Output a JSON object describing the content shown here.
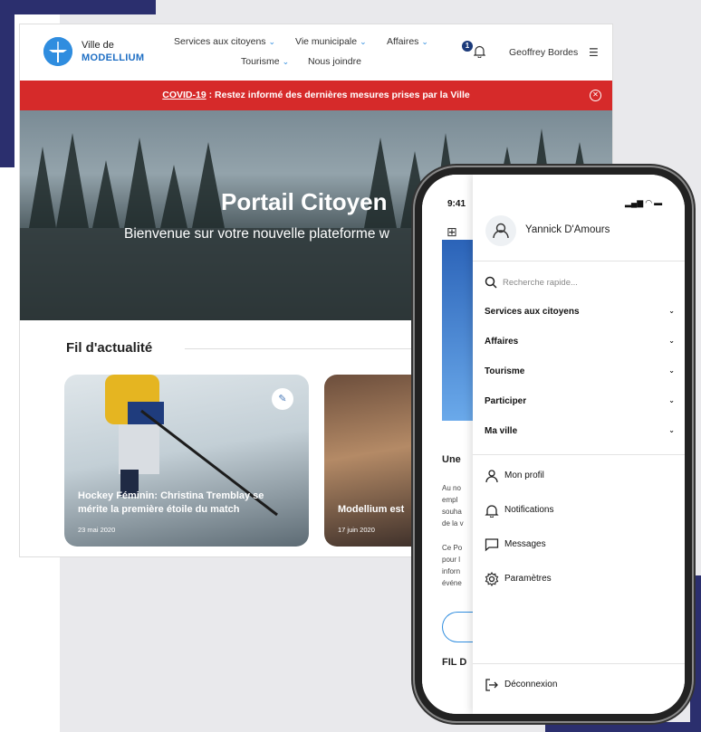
{
  "desktop": {
    "logo": {
      "line1": "Ville de",
      "line2": "MODELLIUM"
    },
    "nav": [
      {
        "label": "Services aux citoyens"
      },
      {
        "label": "Vie municipale"
      },
      {
        "label": "Affaires"
      },
      {
        "label": "Tourisme"
      },
      {
        "label": "Nous joindre"
      }
    ],
    "notifications_count": "1",
    "user_name": "Geoffrey Bordes",
    "covid": {
      "link": "COVID-19",
      "text": " : Restez informé des dernières mesures prises par la Ville"
    },
    "hero": {
      "title": "Portail Citoyen",
      "subtitle": "Bienvenue sur votre nouvelle plateforme w"
    },
    "feed_title": "Fil d'actualité",
    "cards": [
      {
        "title": "Hockey Féminin: Christina Tremblay se mérite la première étoile du match",
        "date": "23 mai 2020"
      },
      {
        "title": "Modellium est",
        "date": "17 juin 2020"
      }
    ]
  },
  "phone": {
    "status_time": "9:41",
    "app": {
      "une": "Une",
      "lines": [
        "Au no",
        "empl",
        "souha",
        "de la v",
        "Ce Po",
        "pour l",
        "inforn",
        "événe"
      ],
      "fil": "FIL D"
    },
    "drawer": {
      "user_name": "Yannick D'Amours",
      "search_placeholder": "Recherche rapide...",
      "menu": [
        "Services aux citoyens",
        "Affaires",
        "Tourisme",
        "Participer",
        "Ma ville"
      ],
      "links": [
        "Mon profil",
        "Notifications",
        "Messages",
        "Paramètres"
      ],
      "logout": "Déconnexion"
    }
  },
  "colors": {
    "accent": "#2f8ddf",
    "alert": "#d62a2a",
    "brand_dark": "#2b2f6e"
  }
}
